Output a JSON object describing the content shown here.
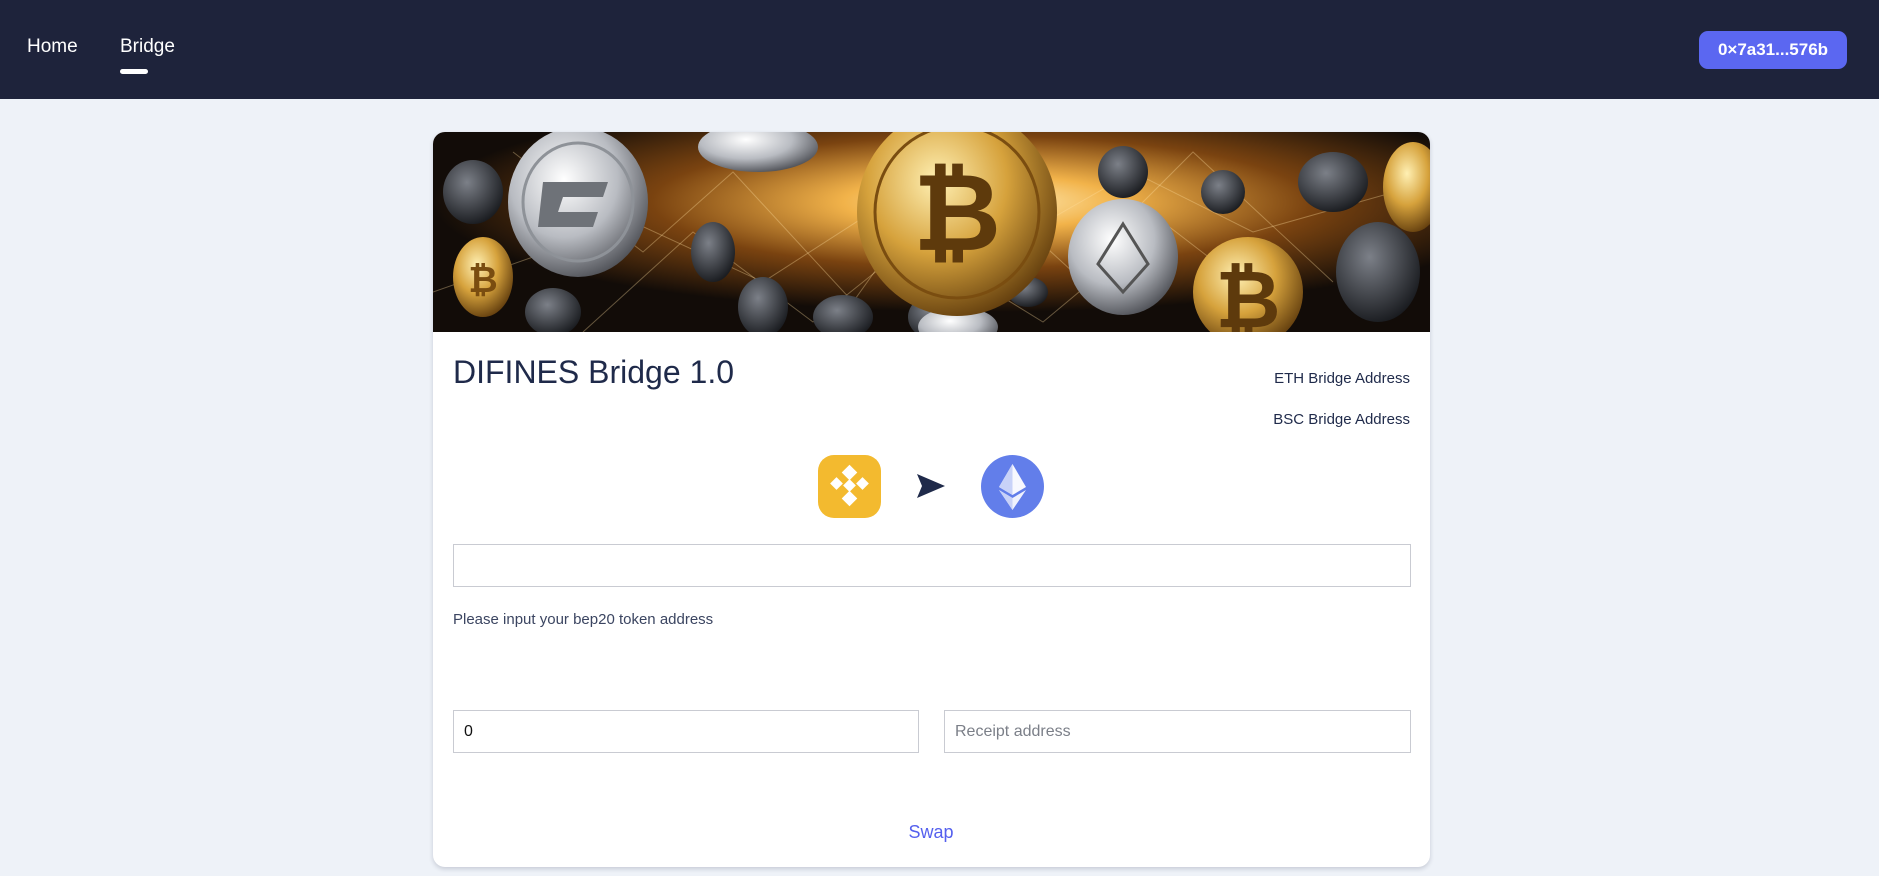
{
  "nav": {
    "items": [
      {
        "label": "Home",
        "active": false
      },
      {
        "label": "Bridge",
        "active": true
      }
    ],
    "wallet_label": "0×7a31...576b"
  },
  "card": {
    "banner_icon": "crypto-coins-banner",
    "title": "DIFINES Bridge 1.0",
    "eth_address_label": "ETH Bridge Address",
    "bsc_address_label": "BSC Bridge Address",
    "from_chain_icon": "bnb-logo-icon",
    "direction_icon": "send-arrow-icon",
    "to_chain_icon": "ethereum-logo-icon",
    "token_address_value": "",
    "token_hint": "Please input your bep20 token address",
    "amount_value": "0",
    "receipt_placeholder": "Receipt address",
    "swap_label": "Swap"
  },
  "colors": {
    "topbar": "#1e233b",
    "accent": "#5b67f1",
    "bnb": "#f3ba2f",
    "eth": "#627eea",
    "background": "#eef2f8"
  }
}
